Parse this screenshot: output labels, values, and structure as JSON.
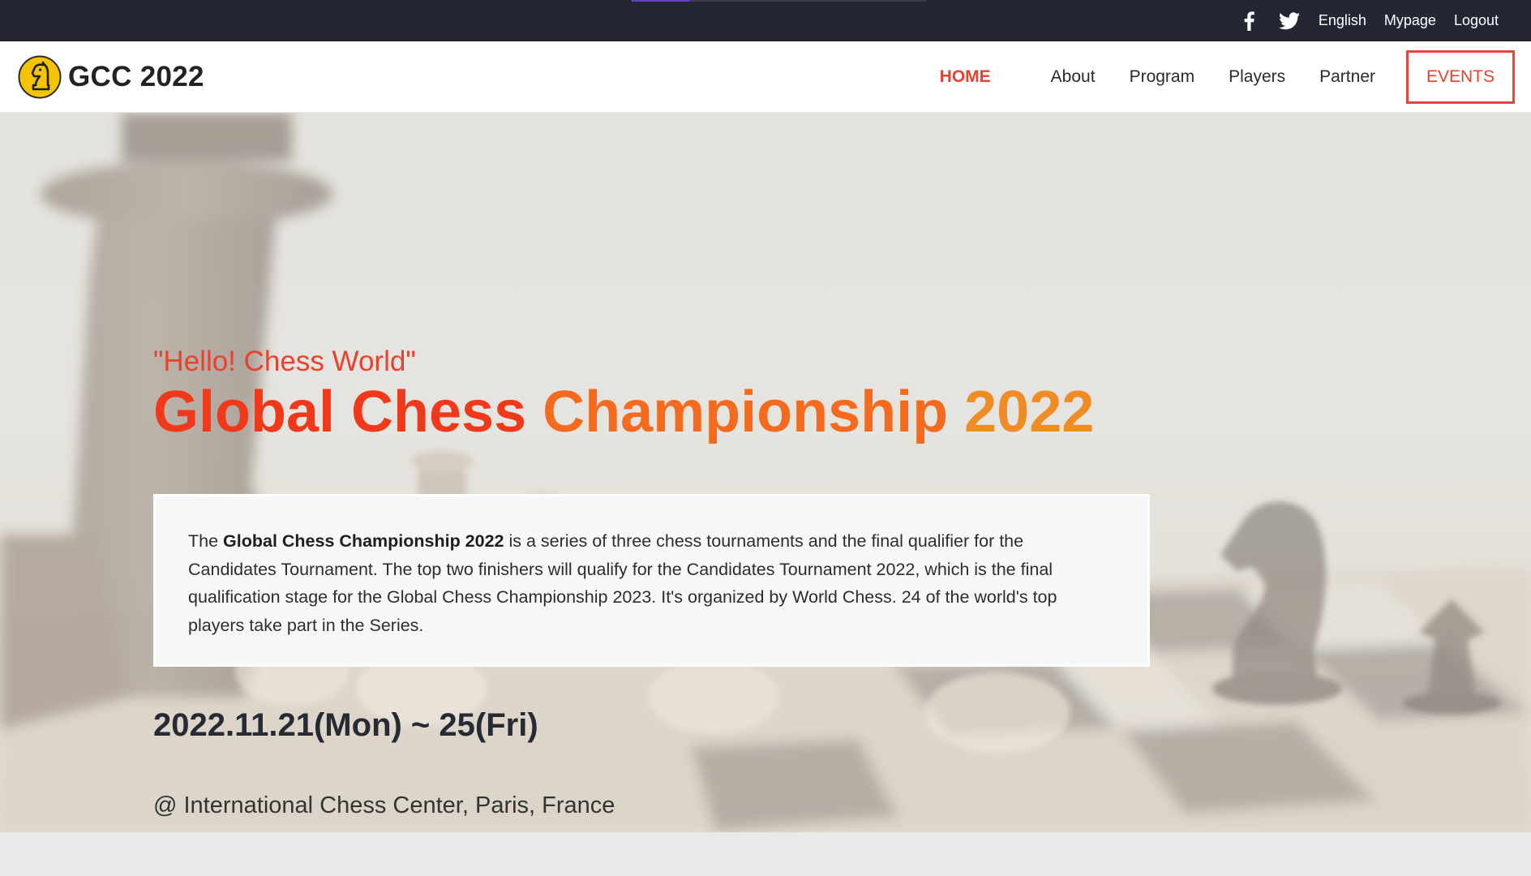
{
  "topbar": {
    "social": [
      {
        "icon": "facebook-icon"
      },
      {
        "icon": "twitter-icon"
      }
    ],
    "links": [
      "English",
      "Mypage",
      "Logout"
    ]
  },
  "brand": {
    "title": "GCC 2022",
    "logo_icon": "chess-knight-icon",
    "logo_color": "#f5c400"
  },
  "nav": {
    "items": [
      "HOME",
      "About",
      "Program",
      "Players",
      "Partner",
      "EVENTS"
    ],
    "active": "HOME",
    "accent_color": "#e8412d"
  },
  "hero": {
    "greeting": "\"Hello! Chess World\"",
    "headline_part1": "Global Chess ",
    "headline_part2": "Championship ",
    "headline_part3": "2022",
    "description": {
      "prefix": "The ",
      "bold": "Global Chess Championship 2022",
      "suffix": " is a series of three chess tournaments and the final qualifier for the Candidates Tournament. The top two finishers will qualify for the Candidates Tournament 2022, which is the final qualification stage for the Global Chess Championship 2023. It's organized by World Chess. 24 of the world's top players take part in the Series."
    },
    "date": "2022.11.21(Mon) ~ 25(Fri)",
    "venue": "@ International Chess Center, Paris, France"
  }
}
